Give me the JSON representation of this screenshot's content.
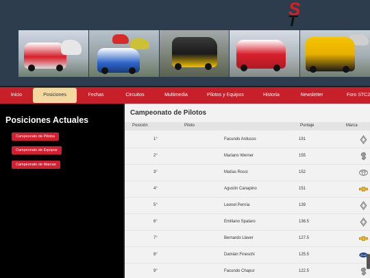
{
  "nav": [
    {
      "label": "Inicio",
      "active": false
    },
    {
      "label": "Posiciones",
      "active": true
    },
    {
      "label": "Fechas",
      "active": false
    },
    {
      "label": "Circuitos",
      "active": false
    },
    {
      "label": "Multimedia",
      "active": false
    },
    {
      "label": "Pilotos y Equipos",
      "active": false
    },
    {
      "label": "Historia",
      "active": false
    },
    {
      "label": "Newsletter",
      "active": false
    },
    {
      "label": "Foro STC2",
      "active": false
    }
  ],
  "sidebar": {
    "title": "Posiciones Actuales",
    "buttons": [
      "Campeonato de Pilotos",
      "Campeonato de Equipos",
      "Campeonato de Marcas"
    ]
  },
  "main": {
    "title": "Campeonato de Pilotos",
    "columns": {
      "pos": "Posición",
      "driver": "Piloto",
      "points": "Puntaje",
      "brand": "Marca"
    },
    "rows": [
      {
        "pos": "1°",
        "driver": "Facundo Ardusso",
        "points": "191",
        "brand": "renault-logo"
      },
      {
        "pos": "2°",
        "driver": "Mariano Werner",
        "points": "155",
        "brand": "peugeot-logo"
      },
      {
        "pos": "3°",
        "driver": "Matías Rossi",
        "points": "152",
        "brand": "toyota-logo"
      },
      {
        "pos": "4°",
        "driver": "Agustín Canapino",
        "points": "151",
        "brand": "chevrolet-logo"
      },
      {
        "pos": "5°",
        "driver": "Leonel Pernía",
        "points": "139",
        "brand": "renault-logo"
      },
      {
        "pos": "6°",
        "driver": "Emiliano Spataro",
        "points": "136.5",
        "brand": "renault-logo"
      },
      {
        "pos": "7°",
        "driver": "Bernardo Llaver",
        "points": "127.5",
        "brand": "chevrolet-logo"
      },
      {
        "pos": "8°",
        "driver": "Damián Fineschi",
        "points": "125.5",
        "brand": "ford-logo"
      },
      {
        "pos": "9°",
        "driver": "Facundo Chapur",
        "points": "122.5",
        "brand": "peugeot-logo"
      }
    ]
  },
  "colors": {
    "nav": "#c8202b",
    "header": "#2e3d4d",
    "button": "#d32030",
    "active_tab": "#f3d9a0"
  }
}
